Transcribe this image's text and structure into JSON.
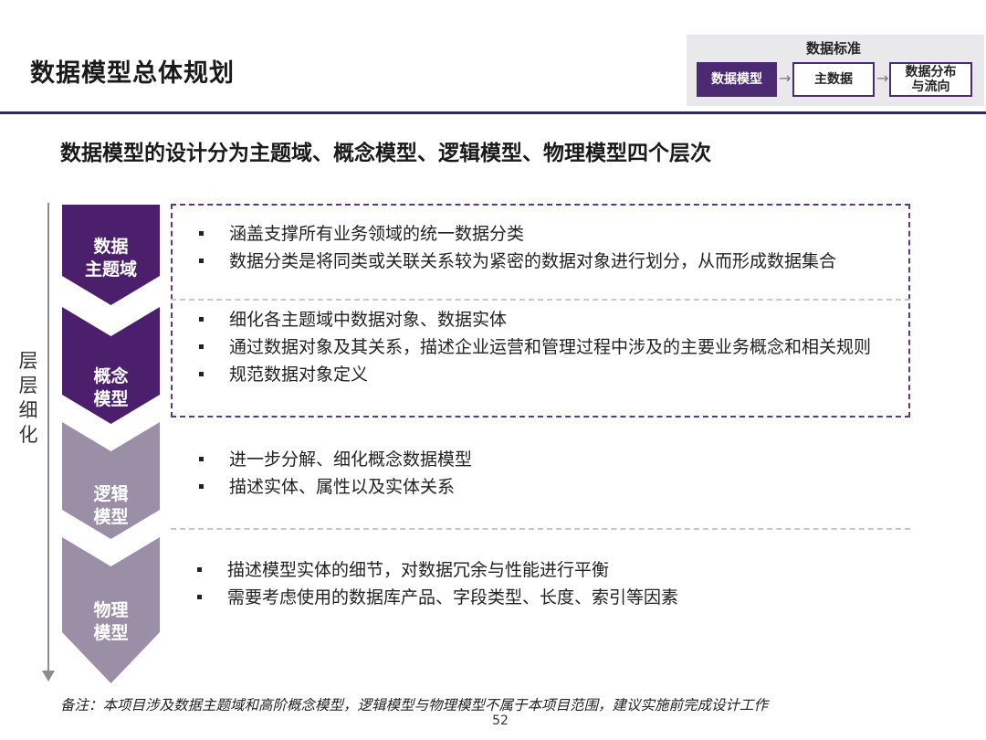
{
  "header": {
    "title": "数据模型总体规划"
  },
  "breadcrumb": {
    "heading": "数据标准",
    "items": [
      {
        "label": "数据模型",
        "state": "active"
      },
      {
        "label": "主数据",
        "state": "inactive"
      },
      {
        "label": "数据分布与流向",
        "line1": "数据分布",
        "line2": "与流向",
        "state": "inactive"
      }
    ],
    "arrow": "→",
    "active_color": "#4b2a72"
  },
  "subtitle": "数据模型的设计分为主题域、概念模型、逻辑模型、物理模型四个层次",
  "side_label": {
    "text": "层层细化",
    "chars": [
      "层",
      "层",
      "细",
      "化"
    ]
  },
  "layers": [
    {
      "name": "数据主题域",
      "line1": "数据",
      "line2": "主题域",
      "color": "#4b1f6b",
      "bullets": [
        "涵盖支撑所有业务领域的统一数据分类",
        "数据分类是将同类或关联关系较为紧密的数据对象进行划分，从而形成数据集合"
      ]
    },
    {
      "name": "概念模型",
      "line1": "概念",
      "line2": "模型",
      "color": "#4b1f6b",
      "bullets": [
        "细化各主题域中数据对象、数据实体",
        "通过数据对象及其关系，描述企业运营和管理过程中涉及的主要业务概念和相关规则",
        "规范数据对象定义"
      ]
    },
    {
      "name": "逻辑模型",
      "line1": "逻辑",
      "line2": "模型",
      "color": "#9a8fa6",
      "bullets": [
        "进一步分解、细化概念数据模型",
        "描述实体、属性以及实体关系"
      ]
    },
    {
      "name": "物理模型",
      "line1": "物理",
      "line2": "模型",
      "color": "#9a8fa6",
      "bullets": [
        "描述模型实体的细节，对数据冗余与性能进行平衡",
        "需要考虑使用的数据库产品、字段类型、长度、索引等因素"
      ]
    }
  ],
  "note": "备注：本项目涉及数据主题域和高阶概念模型，逻辑模型与物理模型不属于本项目范围，建议实施前完成设计工作",
  "page_number": "52"
}
